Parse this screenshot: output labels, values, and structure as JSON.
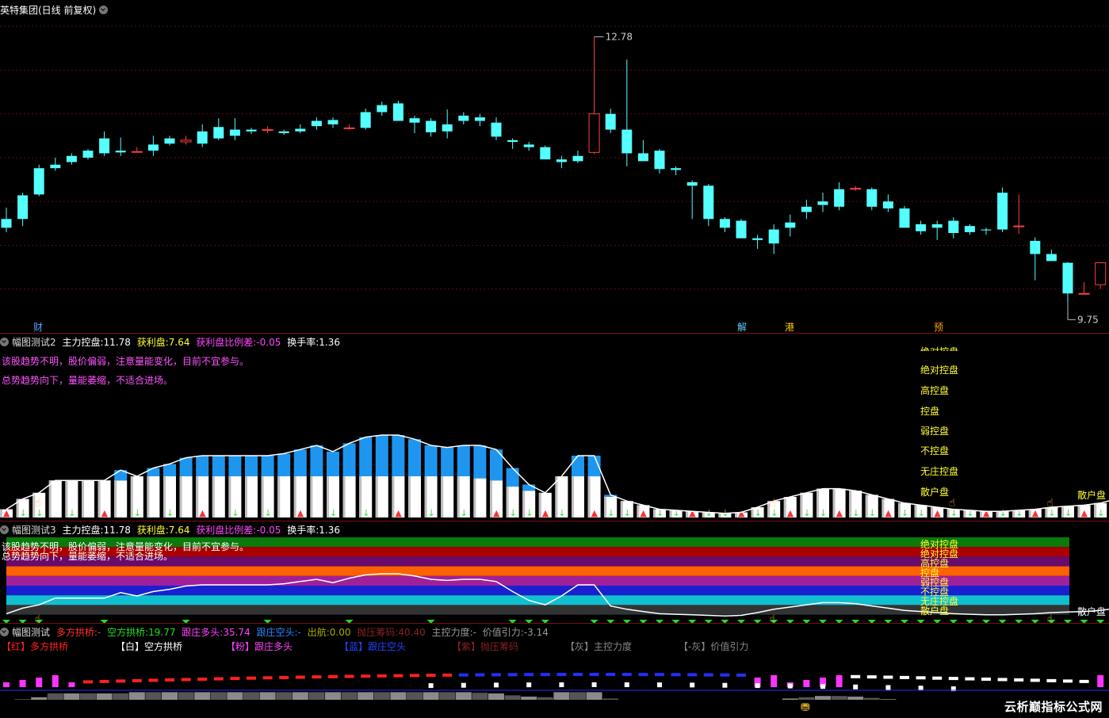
{
  "main": {
    "title": "英特集团(日线 前复权)",
    "high_label": "12.78",
    "low_label": "9.75",
    "markers": [
      "财",
      "解",
      "港",
      "预"
    ],
    "chart_data": {
      "type": "candlestick",
      "ylim": [
        9.4,
        13.2
      ],
      "candles": [
        [
          10.7,
          10.83,
          10.55,
          10.6
        ],
        [
          10.97,
          11.0,
          10.62,
          10.7
        ],
        [
          11.28,
          11.32,
          10.96,
          10.98
        ],
        [
          11.32,
          11.4,
          11.25,
          11.28
        ],
        [
          11.42,
          11.45,
          11.32,
          11.35
        ],
        [
          11.48,
          11.5,
          11.38,
          11.4
        ],
        [
          11.62,
          11.7,
          11.42,
          11.45
        ],
        [
          11.48,
          11.63,
          11.42,
          11.46
        ],
        [
          11.47,
          11.52,
          11.46,
          11.47
        ],
        [
          11.55,
          11.65,
          11.42,
          11.48
        ],
        [
          11.62,
          11.65,
          11.54,
          11.56
        ],
        [
          11.58,
          11.65,
          11.55,
          11.6
        ],
        [
          11.7,
          11.78,
          11.52,
          11.56
        ],
        [
          11.75,
          11.85,
          11.6,
          11.62
        ],
        [
          11.72,
          11.85,
          11.6,
          11.65
        ],
        [
          11.72,
          11.74,
          11.67,
          11.7
        ],
        [
          11.72,
          11.76,
          11.68,
          11.72
        ],
        [
          11.7,
          11.72,
          11.66,
          11.68
        ],
        [
          11.73,
          11.78,
          11.68,
          11.7
        ],
        [
          11.82,
          11.86,
          11.72,
          11.76
        ],
        [
          11.83,
          11.86,
          11.74,
          11.78
        ],
        [
          11.74,
          11.78,
          11.72,
          11.74
        ],
        [
          11.92,
          11.96,
          11.72,
          11.74
        ],
        [
          12.0,
          12.04,
          11.88,
          11.92
        ],
        [
          12.02,
          12.05,
          11.82,
          11.82
        ],
        [
          11.85,
          11.88,
          11.68,
          11.8
        ],
        [
          11.82,
          11.85,
          11.64,
          11.69
        ],
        [
          11.78,
          11.95,
          11.62,
          11.7
        ],
        [
          11.88,
          11.92,
          11.78,
          11.82
        ],
        [
          11.86,
          11.9,
          11.76,
          11.82
        ],
        [
          11.8,
          11.86,
          11.6,
          11.64
        ],
        [
          11.6,
          11.62,
          11.5,
          11.58
        ],
        [
          11.55,
          11.58,
          11.48,
          11.52
        ],
        [
          11.52,
          11.54,
          11.38,
          11.38
        ],
        [
          11.38,
          11.42,
          11.28,
          11.35
        ],
        [
          11.42,
          11.48,
          11.34,
          11.36
        ],
        [
          11.46,
          12.78,
          11.44,
          11.9
        ],
        [
          11.9,
          11.96,
          11.68,
          11.72
        ],
        [
          11.72,
          12.52,
          11.3,
          11.45
        ],
        [
          11.45,
          11.6,
          11.36,
          11.36
        ],
        [
          11.48,
          11.5,
          11.22,
          11.27
        ],
        [
          11.28,
          11.3,
          11.2,
          11.26
        ],
        [
          11.12,
          11.14,
          10.7,
          11.08
        ],
        [
          11.08,
          11.1,
          10.62,
          10.7
        ],
        [
          10.7,
          10.72,
          10.55,
          10.6
        ],
        [
          10.68,
          10.7,
          10.48,
          10.48
        ],
        [
          10.48,
          10.52,
          10.36,
          10.46
        ],
        [
          10.58,
          10.64,
          10.3,
          10.42
        ],
        [
          10.66,
          10.75,
          10.5,
          10.6
        ],
        [
          10.84,
          10.92,
          10.7,
          10.78
        ],
        [
          10.9,
          11.0,
          10.78,
          10.86
        ],
        [
          11.04,
          11.12,
          10.8,
          10.84
        ],
        [
          11.05,
          11.08,
          11.02,
          11.05
        ],
        [
          11.04,
          11.06,
          10.8,
          10.84
        ],
        [
          10.9,
          10.98,
          10.78,
          10.82
        ],
        [
          10.82,
          10.85,
          10.6,
          10.6
        ],
        [
          10.64,
          10.68,
          10.52,
          10.56
        ],
        [
          10.64,
          10.68,
          10.46,
          10.6
        ],
        [
          10.68,
          10.72,
          10.48,
          10.54
        ],
        [
          10.62,
          10.64,
          10.52,
          10.55
        ],
        [
          10.58,
          10.6,
          10.52,
          10.57
        ],
        [
          11.0,
          11.06,
          10.55,
          10.58
        ],
        [
          10.62,
          10.98,
          10.53,
          10.62
        ],
        [
          10.45,
          10.49,
          10.0,
          10.3
        ],
        [
          10.3,
          10.35,
          10.22,
          10.22
        ],
        [
          10.2,
          10.21,
          9.75,
          9.85
        ],
        [
          9.85,
          9.98,
          9.85,
          9.85
        ],
        [
          9.95,
          10.2,
          9.9,
          10.2
        ],
        [
          10.24,
          10.38,
          10.08,
          10.38
        ],
        [
          10.38,
          10.5,
          10.3,
          10.32
        ]
      ]
    }
  },
  "panel2": {
    "title": "幅图测试2",
    "fields": [
      {
        "label": "主力控盘:",
        "value": "11.78",
        "color": "#ffffff"
      },
      {
        "label": "获利盘:",
        "value": "7.64",
        "color": "#ffff33"
      },
      {
        "label": "获利盘比例差:",
        "value": "-0.05",
        "color": "#ff44ff"
      },
      {
        "label": "换手率:",
        "value": "1.36",
        "color": "#ffffff"
      }
    ],
    "note1": "该股趋势不明，股价偏弱，注意量能变化，目前不宜参与。",
    "note2": "总势趋势向下，量能萎缩，不适合进场。",
    "levels": [
      "绝对控盘",
      "绝对控盘",
      "高控盘",
      "控盘",
      "弱控盘",
      "不控盘",
      "无庄控盘",
      "散户盘"
    ],
    "right_label": "散户盘",
    "chart_data": {
      "type": "bar",
      "ylim": [
        0,
        10
      ],
      "white": [
        0.4,
        0.9,
        1.2,
        1.8,
        1.8,
        1.8,
        1.8,
        1.8,
        2.0,
        2.0,
        2.0,
        2.0,
        2.0,
        2.0,
        2.0,
        2.0,
        2.0,
        2.0,
        2.0,
        2.0,
        2.0,
        2.0,
        2.0,
        2.0,
        2.0,
        2.0,
        2.0,
        2.0,
        2.0,
        1.9,
        1.8,
        1.5,
        1.3,
        1.2,
        2.0,
        2.0,
        2.0,
        1.0,
        0.8,
        0.6,
        0.4,
        0.35,
        0.3,
        0.25,
        0.2,
        0.25,
        0.5,
        0.8,
        1.0,
        1.2,
        1.4,
        1.4,
        1.3,
        1.1,
        0.9,
        0.7,
        0.6,
        0.5,
        0.4,
        0.35,
        0.3,
        0.3,
        0.35,
        0.4,
        0.5,
        0.55,
        0.6,
        0.7,
        0.9,
        1.0,
        1.2,
        1.2
      ],
      "blue": [
        0,
        0,
        0,
        0,
        0,
        0,
        0,
        0.5,
        0,
        0.4,
        0.6,
        0.9,
        1.0,
        1.0,
        1.0,
        1.0,
        1.0,
        1.1,
        1.3,
        1.5,
        1.2,
        1.6,
        1.9,
        2.0,
        2.0,
        1.8,
        1.5,
        1.4,
        1.5,
        1.6,
        1.5,
        0.9,
        0.3,
        0,
        0,
        1.0,
        1.0,
        0.1,
        0,
        0,
        0,
        0,
        0,
        0,
        0,
        0,
        0,
        0,
        0,
        0,
        0,
        0,
        0,
        0,
        0,
        0,
        0,
        0,
        0,
        0,
        0,
        0,
        0,
        0,
        0,
        0,
        0,
        0,
        0,
        0,
        0,
        0
      ]
    }
  },
  "panel3": {
    "title": "幅图测试3",
    "fields": [
      {
        "label": "主力控盘:",
        "value": "11.78",
        "color": "#ffffff"
      },
      {
        "label": "获利盘:",
        "value": "7.64",
        "color": "#ffff33"
      },
      {
        "label": "获利盘比例差:",
        "value": "-0.05",
        "color": "#ff44ff"
      },
      {
        "label": "换手率:",
        "value": "1.36",
        "color": "#ffffff"
      }
    ],
    "note1": "该股趋势不明，股价偏弱，注意量能变化，目前不宜参与。",
    "note2": "总势趋势向下，量能萎缩，不适合进场。",
    "levels": [
      "绝对控盘",
      "绝对控盘",
      "高控盘",
      "控盘",
      "弱控盘",
      "不控盘",
      "无庄控盘",
      "散户盘"
    ],
    "right_label": "散户盘",
    "band_colors": [
      "#0a7a0a",
      "#aa0000",
      "#6a0a6a",
      "#ff6000",
      "#a0209a",
      "#1a20d0",
      "#10c0d0",
      "#333333"
    ]
  },
  "panel4": {
    "title": "幅图测试",
    "fields": [
      {
        "label": "多方拱桥:",
        "value": "-",
        "color": "#ff3030"
      },
      {
        "label": "空方拱桥:",
        "value": "19.77",
        "color": "#22dd22"
      },
      {
        "label": "跟庄多头:",
        "value": "35.74",
        "color": "#ff44ff"
      },
      {
        "label": "跟庄空头:",
        "value": "-",
        "color": "#2288ff"
      },
      {
        "label": "出航:",
        "value": "0.00",
        "color": "#aaaa00"
      },
      {
        "label": "抛压筹码:",
        "value": "40.40",
        "color": "#882222"
      },
      {
        "label": "主控力度:",
        "value": "-",
        "color": "#999999"
      },
      {
        "label": "价值引力:",
        "value": "-3.14",
        "color": "#999999"
      }
    ],
    "legend": [
      {
        "tag": "【红】",
        "name": "多方拱桥",
        "color": "#ff2020"
      },
      {
        "tag": "【白】",
        "name": "空方拱桥",
        "color": "#ffffff"
      },
      {
        "tag": "【粉】",
        "name": "跟庄多头",
        "color": "#ff44ff"
      },
      {
        "tag": "【蓝】",
        "name": "跟庄空头",
        "color": "#2244ff"
      },
      {
        "tag": "【紫】",
        "name": "抛压筹码",
        "color": "#882222"
      },
      {
        "tag": "【灰】",
        "name": "主控力度",
        "color": "#888888"
      },
      {
        "tag": "【-灰】",
        "name": "价值引力",
        "color": "#888888"
      }
    ]
  },
  "watermark": "云析巅指标公式网",
  "colors": {
    "up": "#ff4040",
    "down": "#54ffff",
    "separator": "#7a1010"
  }
}
